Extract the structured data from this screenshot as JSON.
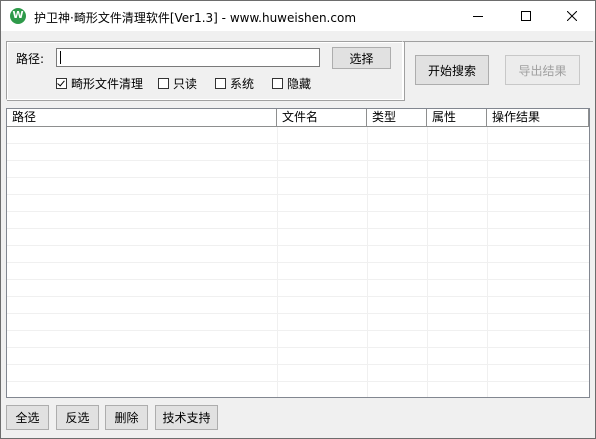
{
  "window": {
    "title": "护卫神·畸形文件清理软件[Ver1.3] - www.huweishen.com",
    "icon_name": "shield-w-icon",
    "icon_glyph": "W"
  },
  "search": {
    "path_label": "路径:",
    "path_value": "",
    "select_label": "选择",
    "start_label": "开始搜索",
    "export_label": "导出结果"
  },
  "options": [
    {
      "label": "畸形文件清理",
      "checked": true
    },
    {
      "label": "只读",
      "checked": false
    },
    {
      "label": "系统",
      "checked": false
    },
    {
      "label": "隐藏",
      "checked": false
    }
  ],
  "table": {
    "columns": [
      "路径",
      "文件名",
      "类型",
      "属性",
      "操作结果"
    ],
    "rows": []
  },
  "footer": {
    "select_all": "全选",
    "invert": "反选",
    "delete": "删除",
    "support": "技术支持"
  }
}
